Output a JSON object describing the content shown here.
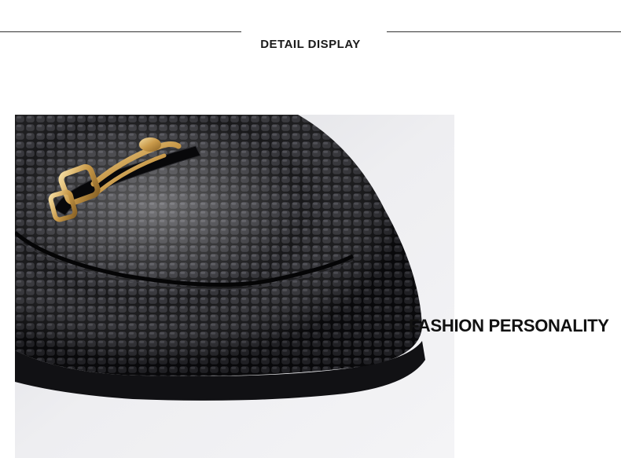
{
  "header": {
    "title": "DETAIL DISPLAY"
  },
  "product_image": {
    "caption": "FASHION PERSONALITY"
  },
  "colors": {
    "background": "#ffffff",
    "rule": "#333333",
    "leather": "#0d0d0f",
    "buckle": "#c99a4a",
    "photo_background": "#e9e9ec"
  }
}
